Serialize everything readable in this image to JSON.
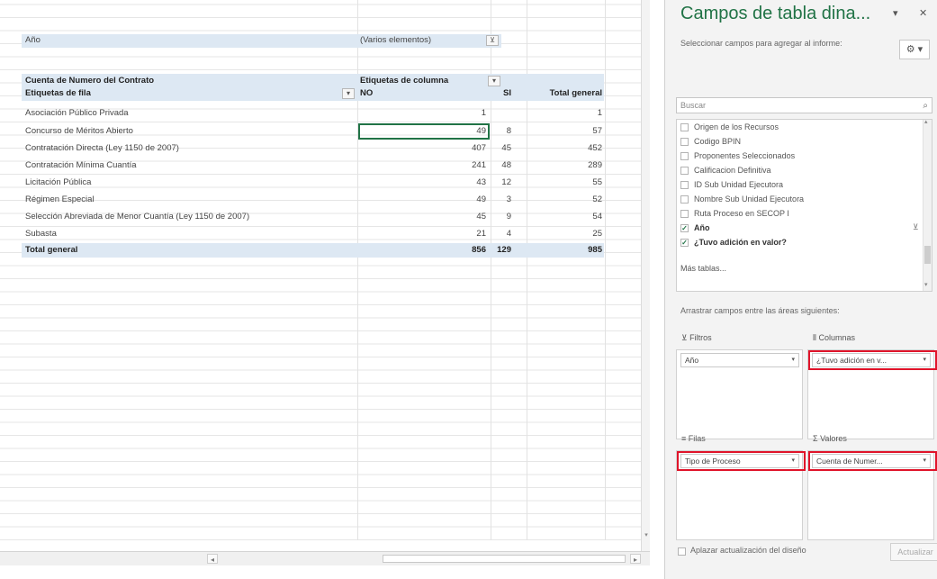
{
  "pivot": {
    "filter_field": "Año",
    "filter_value": "(Varios elementos)",
    "values_label": "Cuenta de Numero del Contrato",
    "column_labels": "Etiquetas de columna",
    "row_labels": "Etiquetas de fila",
    "col_no": "NO",
    "col_si": "SI",
    "col_total": "Total general",
    "rows": [
      {
        "label": "Asociación Público Privada",
        "no": "1",
        "si": "",
        "total": "1"
      },
      {
        "label": "Concurso de Méritos Abierto",
        "no": "49",
        "si": "8",
        "total": "57"
      },
      {
        "label": "Contratación Directa (Ley 1150 de 2007)",
        "no": "407",
        "si": "45",
        "total": "452"
      },
      {
        "label": "Contratación Mínima Cuantía",
        "no": "241",
        "si": "48",
        "total": "289"
      },
      {
        "label": "Licitación Pública",
        "no": "43",
        "si": "12",
        "total": "55"
      },
      {
        "label": "Régimen Especial",
        "no": "49",
        "si": "3",
        "total": "52"
      },
      {
        "label": "Selección Abreviada de Menor Cuantía (Ley 1150 de 2007)",
        "no": "45",
        "si": "9",
        "total": "54"
      },
      {
        "label": "Subasta",
        "no": "21",
        "si": "4",
        "total": "25"
      }
    ],
    "grand_total": {
      "label": "Total general",
      "no": "856",
      "si": "129",
      "total": "985"
    }
  },
  "pane": {
    "title": "Campos de tabla dina...",
    "subtitle": "Seleccionar campos para agregar al informe:",
    "search_placeholder": "Buscar",
    "fields": [
      {
        "label": "Origen de los Recursos",
        "checked": false
      },
      {
        "label": "Codigo BPIN",
        "checked": false
      },
      {
        "label": "Proponentes Seleccionados",
        "checked": false
      },
      {
        "label": "Calificacion Definitiva",
        "checked": false
      },
      {
        "label": "ID Sub Unidad Ejecutora",
        "checked": false
      },
      {
        "label": "Nombre Sub Unidad Ejecutora",
        "checked": false
      },
      {
        "label": "Ruta Proceso en SECOP I",
        "checked": false
      },
      {
        "label": "Año",
        "checked": true
      },
      {
        "label": "¿Tuvo adición en valor?",
        "checked": true
      }
    ],
    "more_tables": "Más tablas...",
    "drag_label": "Arrastrar campos entre las áreas siguientes:",
    "areas": {
      "filters": {
        "title": "Filtros",
        "item": "Año"
      },
      "columns": {
        "title": "Columnas",
        "item": "¿Tuvo adición en v..."
      },
      "rows": {
        "title": "Filas",
        "item": "Tipo de Proceso"
      },
      "values": {
        "title": "Valores",
        "item": "Cuenta de Numer..."
      }
    },
    "defer_label": "Aplazar actualización del diseño",
    "update_label": "Actualizar"
  },
  "colors": {
    "accent": "#217346",
    "header_band": "#dde8f3",
    "highlight": "#e0142a"
  }
}
